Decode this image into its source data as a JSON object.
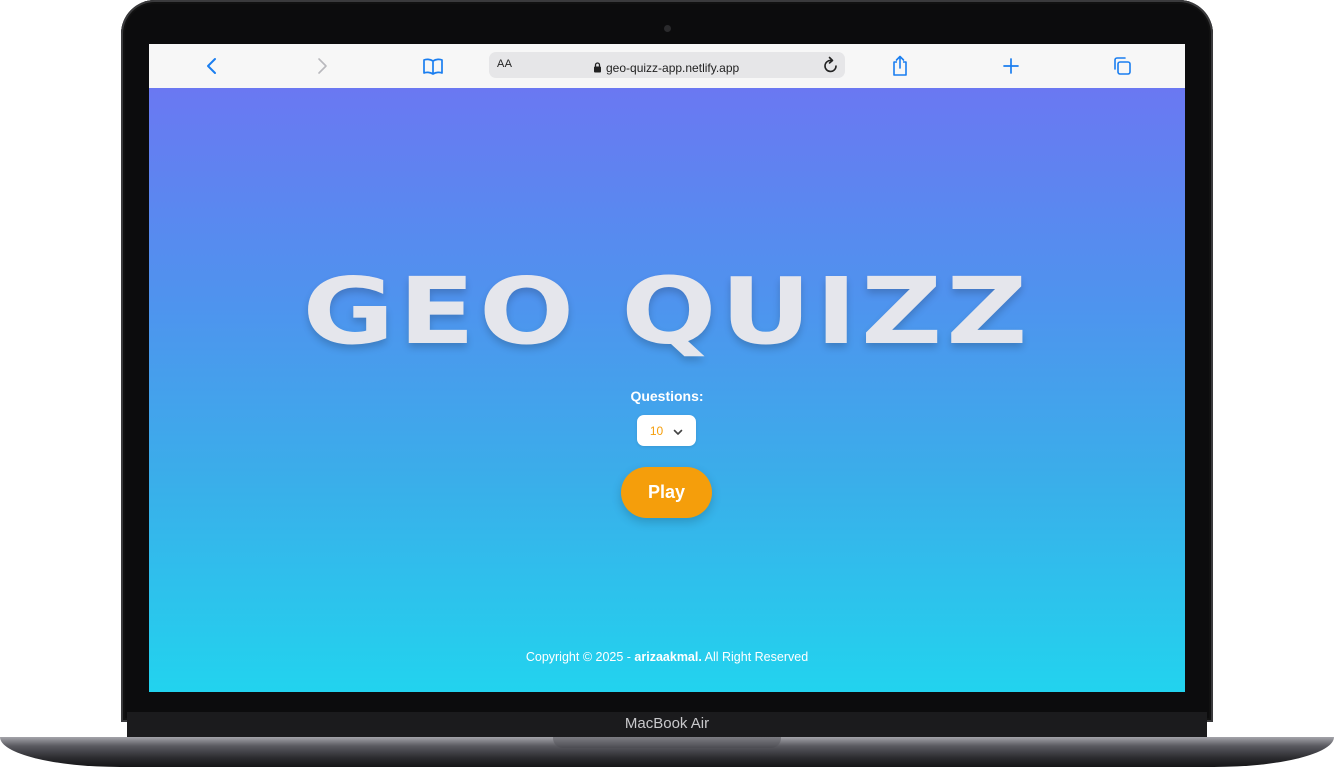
{
  "device": {
    "label": "MacBook Air"
  },
  "browser": {
    "reader_label": "AA",
    "url": "geo-quizz-app.netlify.app",
    "icons": [
      "back-icon",
      "forward-icon",
      "bookmarks-icon",
      "lock-icon",
      "reload-icon",
      "share-icon",
      "new-tab-icon",
      "tabs-icon"
    ]
  },
  "app": {
    "title": "GEO QUIZZ",
    "questions_label": "Questions:",
    "questions_selected": "10",
    "play_label": "Play",
    "colors": {
      "accent": "#f59e0b",
      "gradient_top": "#6a78f2",
      "gradient_bottom": "#22d3ee"
    }
  },
  "footer": {
    "prefix": "Copyright © 2025 - ",
    "author": "arizaakmal.",
    "suffix": " All Right Reserved"
  }
}
